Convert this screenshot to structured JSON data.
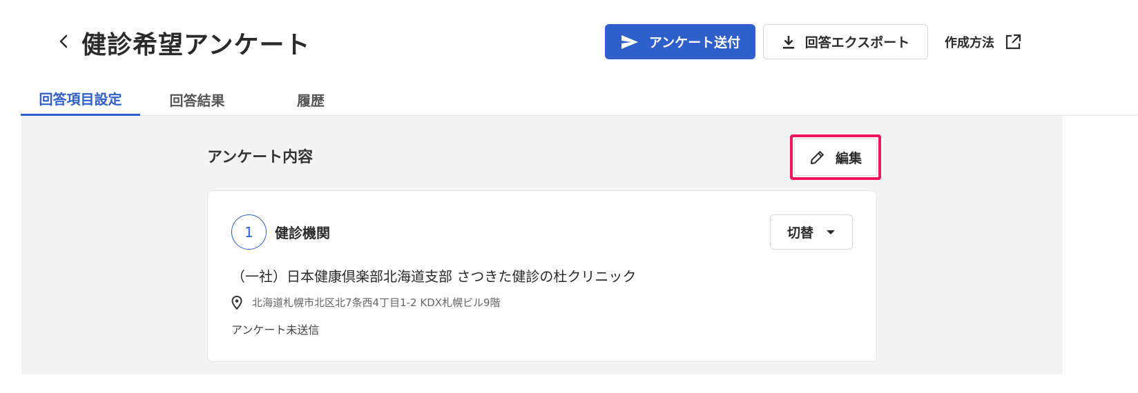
{
  "header": {
    "title": "健診希望アンケート",
    "send_label": "アンケート送付",
    "export_label": "回答エクスポート",
    "howto_label": "作成方法"
  },
  "tabs": [
    {
      "label": "回答項目設定",
      "active": true
    },
    {
      "label": "回答結果",
      "active": false
    },
    {
      "label": "履歴",
      "active": false
    }
  ],
  "section": {
    "title": "アンケート内容",
    "edit_label": "編集"
  },
  "question": {
    "number": "1",
    "title": "健診機関",
    "switch_label": "切替",
    "org_name": "（一社）日本健康倶楽部北海道支部 さつきた健診の杜クリニック",
    "address": "北海道札幌市北区北7条西4丁目1-2 KDX札幌ビル9階",
    "status": "アンケート未送信"
  },
  "colors": {
    "primary": "#2f5fca",
    "highlight": "#f0155c",
    "content_bg": "#f5f4f5"
  },
  "icons": [
    "chevron-left-icon",
    "send-icon",
    "download-icon",
    "external-link-icon",
    "pencil-icon",
    "caret-down-icon",
    "location-pin-icon"
  ]
}
